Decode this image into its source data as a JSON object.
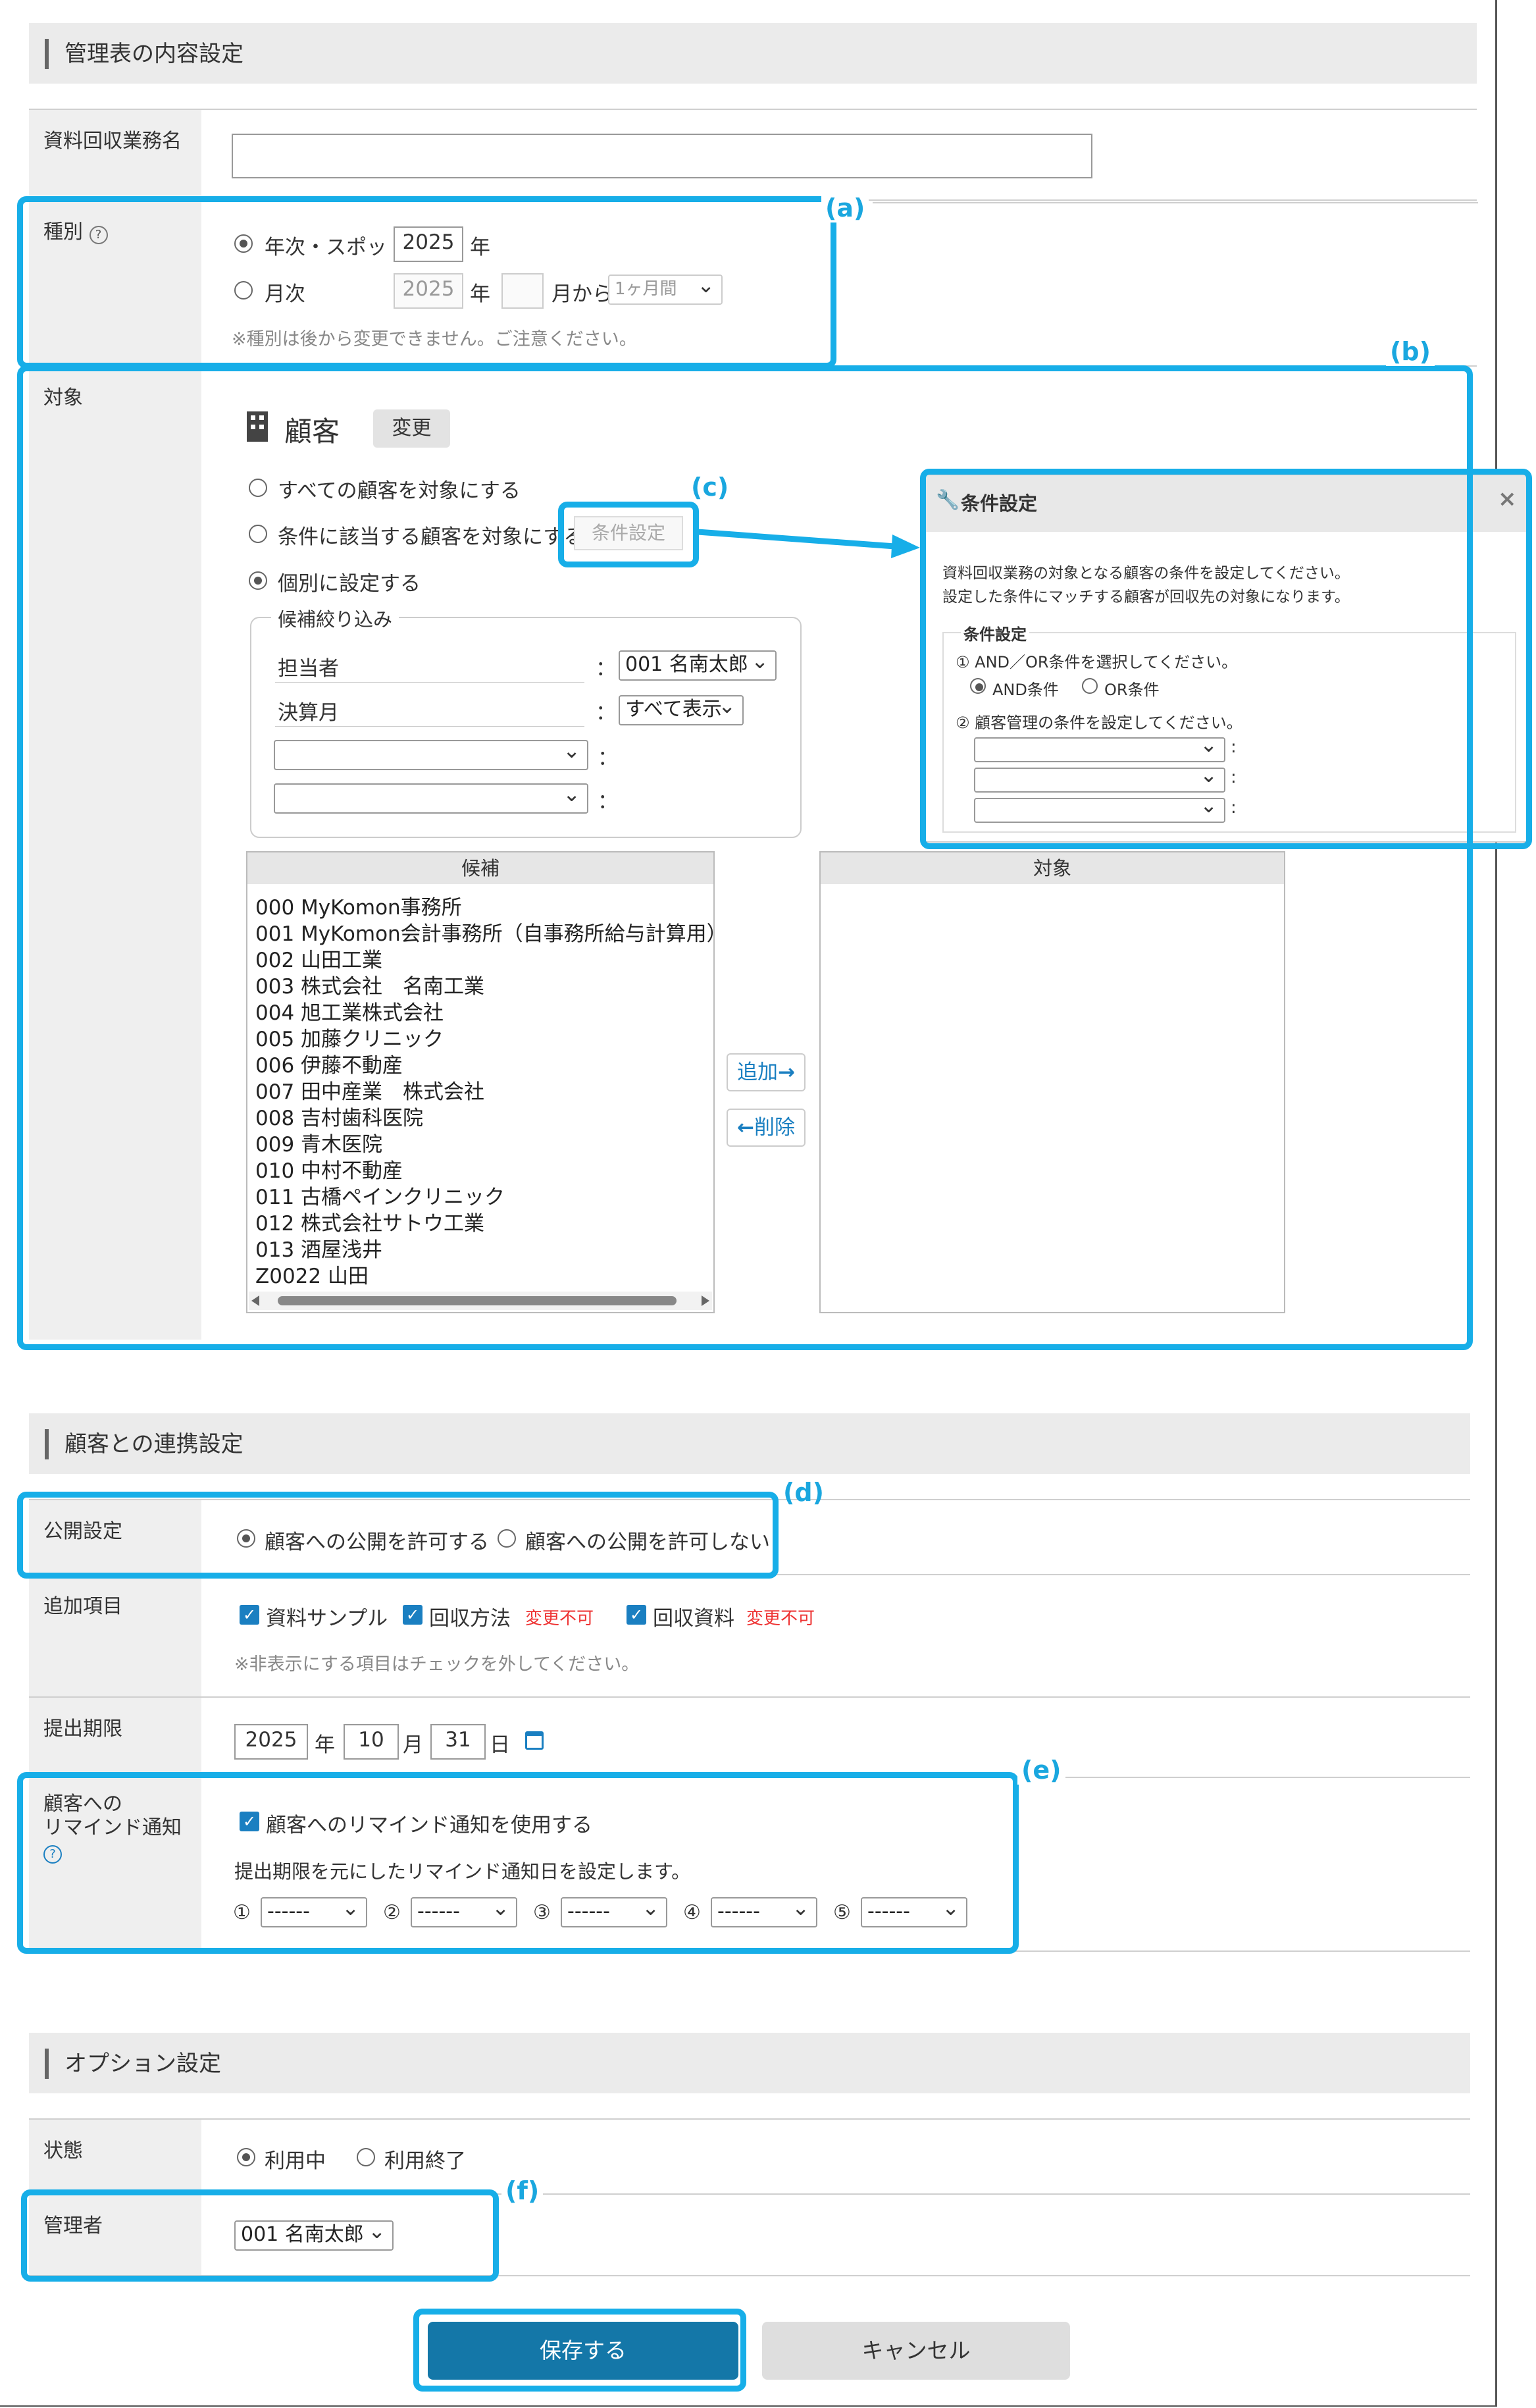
{
  "content_section": {
    "title": "管理表の内容設定",
    "task_name_label": "資料回収業務名",
    "task_name_value": "",
    "type_label": "種別",
    "type_options": {
      "annual_label": "年次・スポット",
      "annual_year": "2025",
      "year_unit": "年",
      "monthly_label": "月次",
      "monthly_year": "2025",
      "month_from": "月から",
      "period": "1ヶ月間"
    },
    "type_note": "※種別は後から変更できません。ご注意ください。",
    "target_label": "対象",
    "target_heading": "顧客",
    "change_button": "変更",
    "target_options": [
      "すべての顧客を対象にする",
      "条件に該当する顧客を対象にする",
      "個別に設定する"
    ],
    "condition_button": "条件設定",
    "filter": {
      "legend": "候補絞り込み",
      "rows": [
        {
          "label": "担当者",
          "value": "001 名南太郎"
        },
        {
          "label": "決算月",
          "value": "すべて表示"
        }
      ],
      "colon": "："
    },
    "candidate_header": "候補",
    "target_header": "対象",
    "candidates": [
      "000 MyKomon事務所",
      "001 MyKomon会計事務所（自事務所給与計算用）",
      "002 山田工業",
      "003 株式会社　名南工業",
      "004 旭工業株式会社",
      "005 加藤クリニック",
      "006 伊藤不動産",
      "007 田中産業　株式会社",
      "008 吉村歯科医院",
      "009 青木医院",
      "010 中村不動産",
      "011 古橋ペインクリニック",
      "012 株式会社サトウ工業",
      "013 酒屋浅井",
      "Z0022 山田"
    ],
    "add_button": "追加",
    "remove_button": "削除"
  },
  "condition_dialog": {
    "title": "条件設定",
    "description1": "資料回収業務の対象となる顧客の条件を設定してください。",
    "description2": "設定した条件にマッチする顧客が回収先の対象になります。",
    "group_title": "条件設定",
    "step1": "① AND／OR条件を選択してください。",
    "and_label": "AND条件",
    "or_label": "OR条件",
    "step2": "② 顧客管理の条件を設定してください。",
    "colon": ":"
  },
  "link_section": {
    "title": "顧客との連携設定",
    "publish_label": "公開設定",
    "publish_allow": "顧客への公開を許可する",
    "publish_deny": "顧客への公開を許可しない",
    "extra_label": "追加項目",
    "extra_items": [
      "資料サンプル",
      "回収方法",
      "回収資料"
    ],
    "unchangeable": "変更不可",
    "extra_note": "※非表示にする項目はチェックを外してください。",
    "deadline_label": "提出期限",
    "deadline_year": "2025",
    "deadline_month": "10",
    "deadline_day": "31",
    "year_unit": "年",
    "month_unit": "月",
    "day_unit": "日",
    "remind_label1": "顧客への",
    "remind_label2": "リマインド通知",
    "remind_check": "顧客へのリマインド通知を使用する",
    "remind_note": "提出期限を元にしたリマインド通知日を設定します。",
    "remind_marks": [
      "①",
      "②",
      "③",
      "④",
      "⑤"
    ],
    "remind_value": "------"
  },
  "option_section": {
    "title": "オプション設定",
    "status_label": "状態",
    "status_active": "利用中",
    "status_ended": "利用終了",
    "manager_label": "管理者",
    "manager_value": "001 名南太郎"
  },
  "actions": {
    "save": "保存する",
    "cancel": "キャンセル"
  },
  "callouts": [
    "(a)",
    "(b)",
    "(c)",
    "(d)",
    "(e)",
    "(f)"
  ],
  "colors": {
    "callout": "#17aee8",
    "primary": "#1477a8",
    "check": "#1a7fc1"
  }
}
